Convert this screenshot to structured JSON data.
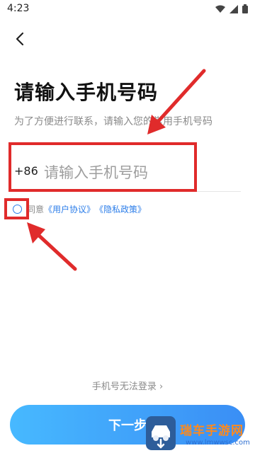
{
  "status_bar": {
    "time": "4:23",
    "wifi_icon": "wifi-icon",
    "signal_icon": "signal-icon",
    "battery_icon": "battery-icon"
  },
  "header": {
    "back_icon": "back-arrow-icon"
  },
  "page": {
    "title": "请输入手机号码",
    "subtitle": "为了方便进行联系，请输入您的常用手机号码"
  },
  "phone": {
    "country_code": "+86",
    "placeholder": "请输入手机号码",
    "value": ""
  },
  "agreement": {
    "checked": false,
    "prefix": "同意",
    "user_agreement": "《用户协议》",
    "privacy_policy": "《隐私政策》"
  },
  "links": {
    "cannot_login": "手机号无法登录 ›"
  },
  "buttons": {
    "next_label": "下一步"
  },
  "watermark": {
    "text": "瑞车手游网",
    "domain": "www.lmwwsc.com"
  },
  "colors": {
    "accent": "#2b7de9",
    "annotation": "#e02b2b",
    "button_start": "#47b9ff",
    "button_end": "#3a8ef5"
  }
}
